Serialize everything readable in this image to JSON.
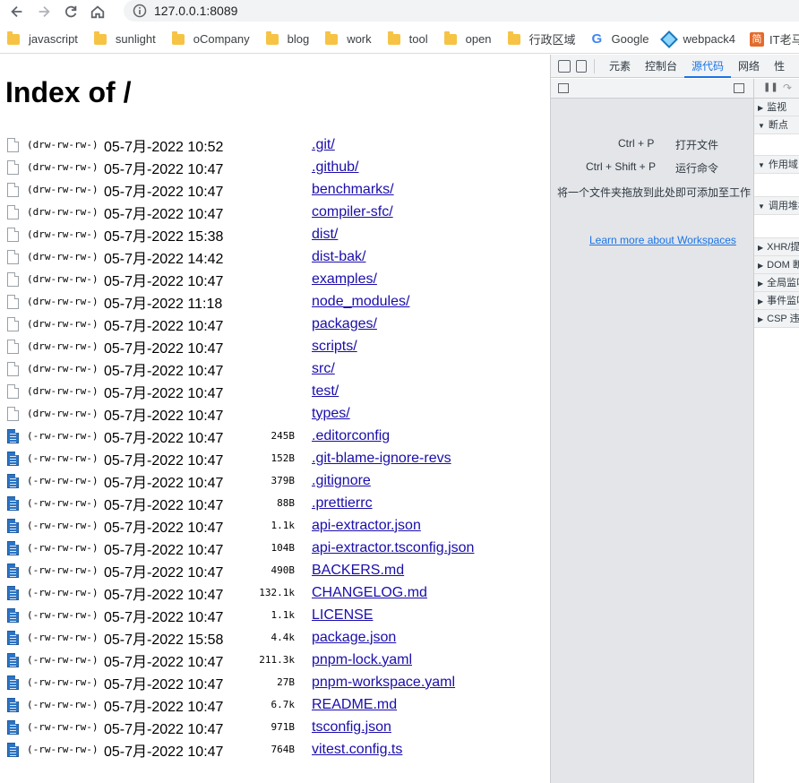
{
  "browser": {
    "url": "127.0.0.1:8089",
    "bookmarks": [
      "javascript",
      "sunlight",
      "oCompany",
      "blog",
      "work",
      "tool",
      "open",
      "行政区域",
      "Google",
      "webpack4",
      "IT老马"
    ]
  },
  "page": {
    "title": "Index of /",
    "entries": [
      {
        "type": "dir",
        "perm": "(drw-rw-rw-)",
        "date": "05-7月-2022 10:52",
        "size": "",
        "name": ".git/"
      },
      {
        "type": "dir",
        "perm": "(drw-rw-rw-)",
        "date": "05-7月-2022 10:47",
        "size": "",
        "name": ".github/"
      },
      {
        "type": "dir",
        "perm": "(drw-rw-rw-)",
        "date": "05-7月-2022 10:47",
        "size": "",
        "name": "benchmarks/"
      },
      {
        "type": "dir",
        "perm": "(drw-rw-rw-)",
        "date": "05-7月-2022 10:47",
        "size": "",
        "name": "compiler-sfc/"
      },
      {
        "type": "dir",
        "perm": "(drw-rw-rw-)",
        "date": "05-7月-2022 15:38",
        "size": "",
        "name": "dist/"
      },
      {
        "type": "dir",
        "perm": "(drw-rw-rw-)",
        "date": "05-7月-2022 14:42",
        "size": "",
        "name": "dist-bak/"
      },
      {
        "type": "dir",
        "perm": "(drw-rw-rw-)",
        "date": "05-7月-2022 10:47",
        "size": "",
        "name": "examples/"
      },
      {
        "type": "dir",
        "perm": "(drw-rw-rw-)",
        "date": "05-7月-2022 11:18",
        "size": "",
        "name": "node_modules/"
      },
      {
        "type": "dir",
        "perm": "(drw-rw-rw-)",
        "date": "05-7月-2022 10:47",
        "size": "",
        "name": "packages/"
      },
      {
        "type": "dir",
        "perm": "(drw-rw-rw-)",
        "date": "05-7月-2022 10:47",
        "size": "",
        "name": "scripts/"
      },
      {
        "type": "dir",
        "perm": "(drw-rw-rw-)",
        "date": "05-7月-2022 10:47",
        "size": "",
        "name": "src/"
      },
      {
        "type": "dir",
        "perm": "(drw-rw-rw-)",
        "date": "05-7月-2022 10:47",
        "size": "",
        "name": "test/"
      },
      {
        "type": "dir",
        "perm": "(drw-rw-rw-)",
        "date": "05-7月-2022 10:47",
        "size": "",
        "name": "types/"
      },
      {
        "type": "file",
        "perm": "(-rw-rw-rw-)",
        "date": "05-7月-2022 10:47",
        "size": "245B",
        "name": ".editorconfig"
      },
      {
        "type": "file",
        "perm": "(-rw-rw-rw-)",
        "date": "05-7月-2022 10:47",
        "size": "152B",
        "name": ".git-blame-ignore-revs"
      },
      {
        "type": "file",
        "perm": "(-rw-rw-rw-)",
        "date": "05-7月-2022 10:47",
        "size": "379B",
        "name": ".gitignore"
      },
      {
        "type": "file",
        "perm": "(-rw-rw-rw-)",
        "date": "05-7月-2022 10:47",
        "size": "88B",
        "name": ".prettierrc"
      },
      {
        "type": "file",
        "perm": "(-rw-rw-rw-)",
        "date": "05-7月-2022 10:47",
        "size": "1.1k",
        "name": "api-extractor.json"
      },
      {
        "type": "file",
        "perm": "(-rw-rw-rw-)",
        "date": "05-7月-2022 10:47",
        "size": "104B",
        "name": "api-extractor.tsconfig.json"
      },
      {
        "type": "file",
        "perm": "(-rw-rw-rw-)",
        "date": "05-7月-2022 10:47",
        "size": "490B",
        "name": "BACKERS.md"
      },
      {
        "type": "file",
        "perm": "(-rw-rw-rw-)",
        "date": "05-7月-2022 10:47",
        "size": "132.1k",
        "name": "CHANGELOG.md"
      },
      {
        "type": "file",
        "perm": "(-rw-rw-rw-)",
        "date": "05-7月-2022 10:47",
        "size": "1.1k",
        "name": "LICENSE"
      },
      {
        "type": "file",
        "perm": "(-rw-rw-rw-)",
        "date": "05-7月-2022 15:58",
        "size": "4.4k",
        "name": "package.json"
      },
      {
        "type": "file",
        "perm": "(-rw-rw-rw-)",
        "date": "05-7月-2022 10:47",
        "size": "211.3k",
        "name": "pnpm-lock.yaml"
      },
      {
        "type": "file",
        "perm": "(-rw-rw-rw-)",
        "date": "05-7月-2022 10:47",
        "size": "27B",
        "name": "pnpm-workspace.yaml"
      },
      {
        "type": "file",
        "perm": "(-rw-rw-rw-)",
        "date": "05-7月-2022 10:47",
        "size": "6.7k",
        "name": "README.md"
      },
      {
        "type": "file",
        "perm": "(-rw-rw-rw-)",
        "date": "05-7月-2022 10:47",
        "size": "971B",
        "name": "tsconfig.json"
      },
      {
        "type": "file",
        "perm": "(-rw-rw-rw-)",
        "date": "05-7月-2022 10:47",
        "size": "764B",
        "name": "vitest.config.ts"
      }
    ]
  },
  "devtools": {
    "tabs": [
      "元素",
      "控制台",
      "源代码",
      "网络",
      "性"
    ],
    "active_tab": "源代码",
    "shortcuts": [
      {
        "keys": "Ctrl + P",
        "action": "打开文件"
      },
      {
        "keys": "Ctrl + Shift + P",
        "action": "运行命令"
      }
    ],
    "drop_hint": "将一个文件夹拖放到此处即可添加至工作",
    "learn_more": "Learn more about Workspaces",
    "sections": [
      "监视",
      "断点",
      "作用域",
      "调用堆栈",
      "XHR/提",
      "DOM 断",
      "全局监听",
      "事件监听",
      "CSP 违规"
    ],
    "accent_color": "#1a73e8"
  }
}
